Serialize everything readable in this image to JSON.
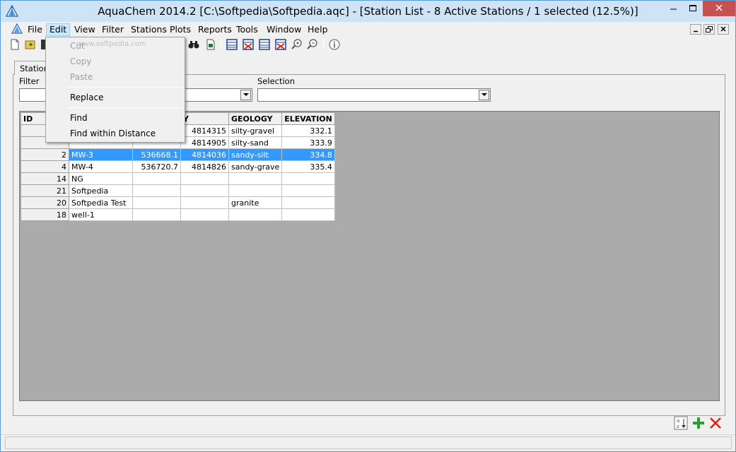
{
  "window": {
    "title": "AquaChem 2014.2 [C:\\Softpedia\\Softpedia.aqc] - [Station List - 8 Active Stations / 1 selected (12.5%)]"
  },
  "menubar": {
    "items": [
      "File",
      "Edit",
      "View",
      "Filter",
      "Stations",
      "Plots",
      "Reports",
      "Tools",
      "Window",
      "Help"
    ],
    "active": "Edit"
  },
  "edit_menu": {
    "items": [
      {
        "label": "Cut",
        "enabled": false
      },
      {
        "label": "Copy",
        "enabled": false
      },
      {
        "label": "Paste",
        "enabled": false
      },
      {
        "label": "Replace",
        "enabled": true
      },
      {
        "label": "Find",
        "enabled": true
      },
      {
        "label": "Find within Distance",
        "enabled": true
      }
    ],
    "watermark": "www.softpedia.com"
  },
  "tabs": {
    "stations_label": "Stations"
  },
  "filter_panel": {
    "filter_label": "Filter",
    "selection_label": "Selection",
    "filter_value": "",
    "selection_value": ""
  },
  "grid": {
    "columns": [
      "ID",
      "",
      "",
      "Y",
      "GEOLOGY",
      "ELEVATION"
    ],
    "rows": [
      {
        "id": "",
        "name": "",
        "x": "",
        "y": "4814315",
        "geology": "silty-gravel",
        "elevation": "332.1",
        "selected": false
      },
      {
        "id": "",
        "name": "",
        "x": "",
        "y": "4814905",
        "geology": "silty-sand",
        "elevation": "333.9",
        "selected": false
      },
      {
        "id": "2",
        "name": "MW-3",
        "x": "536668.1",
        "y": "4814036",
        "geology": "sandy-silt",
        "elevation": "334.8",
        "selected": true
      },
      {
        "id": "4",
        "name": "MW-4",
        "x": "536720.7",
        "y": "4814826",
        "geology": "sandy-grave",
        "elevation": "335.4",
        "selected": false
      },
      {
        "id": "14",
        "name": "NG",
        "x": "",
        "y": "",
        "geology": "",
        "elevation": "",
        "selected": false
      },
      {
        "id": "21",
        "name": "Softpedia",
        "x": "",
        "y": "",
        "geology": "",
        "elevation": "",
        "selected": false
      },
      {
        "id": "20",
        "name": "Softpedia Test",
        "x": "",
        "y": "",
        "geology": "granite",
        "elevation": "",
        "selected": false
      },
      {
        "id": "18",
        "name": "well-1",
        "x": "",
        "y": "",
        "geology": "",
        "elevation": "",
        "selected": false
      }
    ]
  },
  "colors": {
    "selection": "#3399ff",
    "titlebar": "#cfe3f7",
    "close_button": "#c75050",
    "grid_background": "#ababab"
  }
}
